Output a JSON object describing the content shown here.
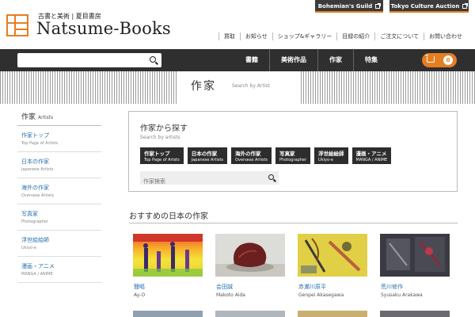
{
  "brand": {
    "subtitle": "古書と美術 | 夏目書房",
    "name": "Natsume-Books"
  },
  "external_links": {
    "guild": "Bohemian's Guild",
    "auction": "Tokyo Culture Auction"
  },
  "top_nav": [
    "買取",
    "お知らせ",
    "ショップ&ギャラリー",
    "目録の紹介",
    "ご注文について",
    "お問い合わせ"
  ],
  "search": {
    "placeholder": ""
  },
  "main_nav": [
    "書籍",
    "美術作品",
    "作家",
    "特集"
  ],
  "cart": {
    "count": "0"
  },
  "page": {
    "title": "作家",
    "subtitle": "Search by Artist"
  },
  "sidebar": {
    "heading": "作家",
    "heading_en": "Artists",
    "items": [
      {
        "label": "作家トップ",
        "sub": "Top Page of Artists"
      },
      {
        "label": "日本の作家",
        "sub": "Japanese Artists"
      },
      {
        "label": "海外の作家",
        "sub": "Overseas Artists"
      },
      {
        "label": "写真家",
        "sub": "Photographer"
      },
      {
        "label": "浮世絵絵師",
        "sub": "Ukiyo-e"
      },
      {
        "label": "漫画・アニメ",
        "sub": "MANGA / ANIME"
      }
    ]
  },
  "panel": {
    "title": "作家から探す",
    "subtitle": "Search by artists",
    "categories": [
      {
        "label": "作家トップ",
        "sub": "Top Page of Artsts"
      },
      {
        "label": "日本の作家",
        "sub": "Japanese Artists"
      },
      {
        "label": "海外の作家",
        "sub": "Overseas Artists"
      },
      {
        "label": "写真家",
        "sub": "Photographer"
      },
      {
        "label": "浮世絵絵師",
        "sub": "Ukiyo-e"
      },
      {
        "label": "漫画・アニメ",
        "sub": "MANGA / ANIME"
      }
    ],
    "search_placeholder": "作家検索"
  },
  "recommended": {
    "title": "おすすめの日本の作家",
    "artists": [
      {
        "name": "靉嘔",
        "romaji": "Ay-O"
      },
      {
        "name": "会田誠",
        "romaji": "Makoto Aida"
      },
      {
        "name": "赤瀬川原平",
        "romaji": "Genpei Akasegawa"
      },
      {
        "name": "荒川修作",
        "romaji": "Syusaku Arakawa"
      }
    ]
  },
  "colors": {
    "accent": "#e67e22",
    "dark": "#2f2f2f",
    "link": "#2a6fb0"
  }
}
